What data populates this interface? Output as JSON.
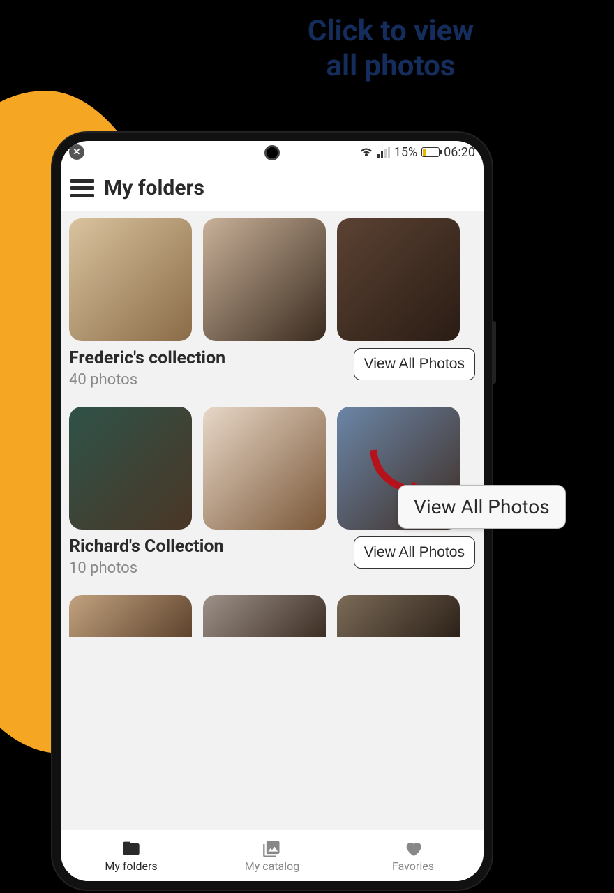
{
  "promo": {
    "line1": "Click to view",
    "line2": "all photos"
  },
  "status_bar": {
    "battery_percent": "15%",
    "time": "06:20"
  },
  "header": {
    "title": "My folders"
  },
  "callout": {
    "label": "View All Photos"
  },
  "folders": [
    {
      "title": "Frederic's collection",
      "count": "40 photos",
      "view_all_label": "View All Photos"
    },
    {
      "title": "Richard's Collection",
      "count": "10 photos",
      "view_all_label": "View All Photos"
    }
  ],
  "bottom_nav": {
    "folders": "My folders",
    "catalog": "My catalog",
    "favorites": "Favories"
  }
}
